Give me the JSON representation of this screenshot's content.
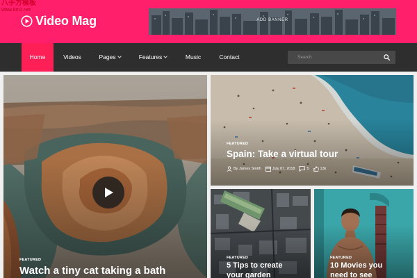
{
  "watermark": {
    "line1": "八手方模板",
    "line2": "www.8m2.net"
  },
  "brand": {
    "name": "Video Mag",
    "logo_icon": "play-circle-icon",
    "accent": "#ff1f6a"
  },
  "ad": {
    "label": "ADD BANNER"
  },
  "nav": {
    "items": [
      {
        "label": "Home",
        "active": true
      },
      {
        "label": "Videos"
      },
      {
        "label": "Pages"
      },
      {
        "label": "Features"
      },
      {
        "label": "Music"
      },
      {
        "label": "Contact"
      }
    ],
    "search_placeholder": "Search"
  },
  "featured_main": {
    "tag": "FEATURED",
    "title": "Watch a tiny cat taking a bath"
  },
  "featured_top_right": {
    "tag": "FEATURED",
    "title": "Spain: Take a virtual tour",
    "author": "By James Smith",
    "date": "July 07, 2018",
    "comments": "5",
    "likes": "13k"
  },
  "card_bottom_left": {
    "tag": "FEATURED",
    "title_line1": "5 Tips to create",
    "title_line2": "your garden"
  },
  "card_bottom_right": {
    "tag": "FEATURED",
    "title_line1": "10 Movies you",
    "title_line2": "need to see"
  }
}
